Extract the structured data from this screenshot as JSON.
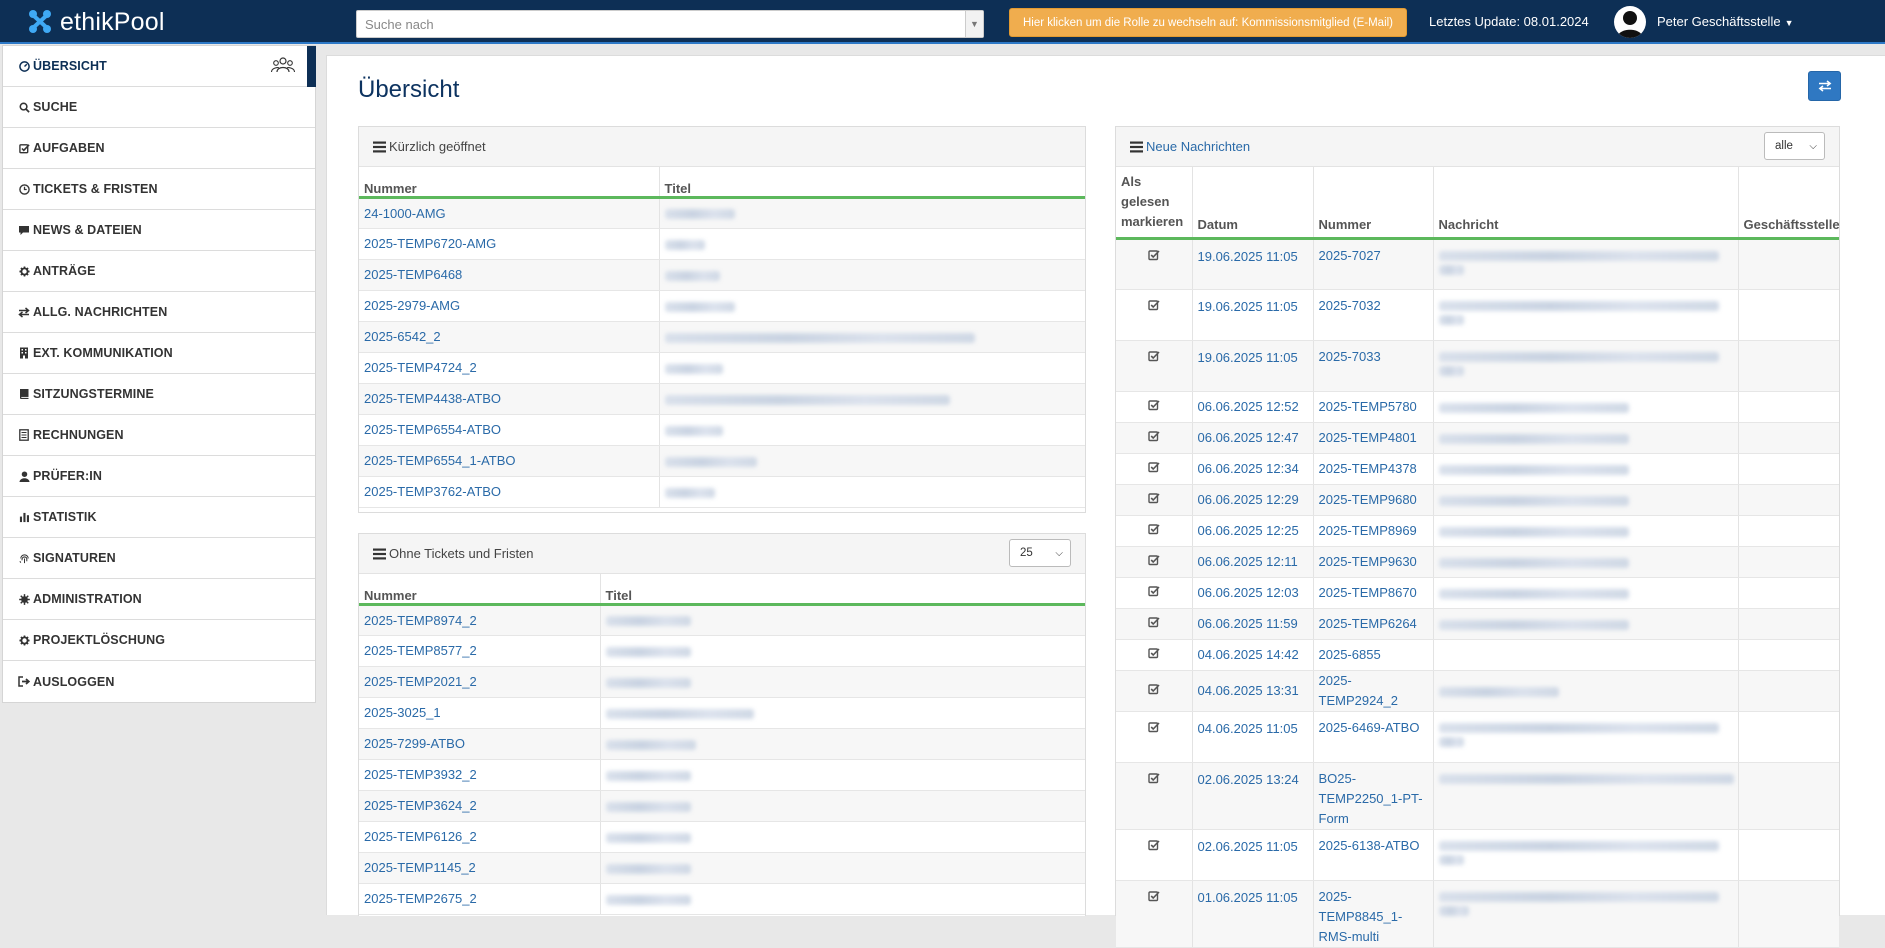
{
  "app": {
    "brand": "ethikPool",
    "search_placeholder": "Suche nach",
    "role_switch": "Hier klicken um die Rolle zu wechseln auf: Kommissionsmitglied (E-Mail)",
    "last_update": "Letztes Update: 08.01.2024",
    "user": "Peter Geschäftsstelle",
    "colors": {
      "navbar": "#0d2f55",
      "accent": "#2f78c2",
      "warning": "#f0ad4e",
      "success_line": "#5cb85c",
      "link": "#2a6aa8"
    }
  },
  "sidebar": {
    "items": [
      {
        "label": "ÜBERSICHT",
        "icon": "dashboard-icon"
      },
      {
        "label": "SUCHE",
        "icon": "search-icon"
      },
      {
        "label": "AUFGABEN",
        "icon": "checkbox-icon"
      },
      {
        "label": "TICKETS & FRISTEN",
        "icon": "clock-icon"
      },
      {
        "label": "NEWS & DATEIEN",
        "icon": "comment-icon"
      },
      {
        "label": "ANTRÄGE",
        "icon": "gear-icon"
      },
      {
        "label": "ALLG. NACHRICHTEN",
        "icon": "exchange-icon"
      },
      {
        "label": "EXT. KOMMUNIKATION",
        "icon": "building-icon"
      },
      {
        "label": "SITZUNGSTERMINE",
        "icon": "book-icon"
      },
      {
        "label": "RECHNUNGEN",
        "icon": "invoice-icon"
      },
      {
        "label": "PRÜFER:IN",
        "icon": "user-icon"
      },
      {
        "label": "STATISTIK",
        "icon": "bar-chart-icon"
      },
      {
        "label": "SIGNATUREN",
        "icon": "fingerprint-icon"
      },
      {
        "label": "ADMINISTRATION",
        "icon": "cog-icon"
      },
      {
        "label": "PROJEKTLÖSCHUNG",
        "icon": "gear-icon"
      },
      {
        "label": "AUSLOGGEN",
        "icon": "logout-icon"
      }
    ]
  },
  "main": {
    "title": "Übersicht",
    "recent": {
      "title": "Kürzlich geöffnet",
      "columns": [
        "Nummer",
        "Titel"
      ],
      "rows": [
        "24-1000-AMG",
        "2025-TEMP6720-AMG",
        "2025-TEMP6468",
        "2025-2979-AMG",
        "2025-6542_2",
        "2025-TEMP4724_2",
        "2025-TEMP4438-ATBO",
        "2025-TEMP6554-ATBO",
        "2025-TEMP6554_1-ATBO",
        "2025-TEMP3762-ATBO"
      ]
    },
    "no_tickets": {
      "title": "Ohne Tickets und Fristen",
      "page_size": "25",
      "columns": [
        "Nummer",
        "Titel"
      ],
      "rows": [
        "2025-TEMP8974_2",
        "2025-TEMP8577_2",
        "2025-TEMP2021_2",
        "2025-3025_1",
        "2025-7299-ATBO",
        "2025-TEMP3932_2",
        "2025-TEMP3624_2",
        "2025-TEMP6126_2",
        "2025-TEMP1145_2",
        "2025-TEMP2675_2"
      ]
    },
    "messages": {
      "title": "Neue Nachrichten",
      "filter": "alle",
      "columns": {
        "mark_read": "Als gelesen markieren",
        "date": "Datum",
        "number": "Nummer",
        "message": "Nachricht",
        "office": "Geschäftsstelle"
      },
      "rows": [
        {
          "date": "19.06.2025 11:05",
          "number": "2025-7027"
        },
        {
          "date": "19.06.2025 11:05",
          "number": "2025-7032"
        },
        {
          "date": "19.06.2025 11:05",
          "number": "2025-7033"
        },
        {
          "date": "06.06.2025 12:52",
          "number": "2025-TEMP5780"
        },
        {
          "date": "06.06.2025 12:47",
          "number": "2025-TEMP4801"
        },
        {
          "date": "06.06.2025 12:34",
          "number": "2025-TEMP4378"
        },
        {
          "date": "06.06.2025 12:29",
          "number": "2025-TEMP9680"
        },
        {
          "date": "06.06.2025 12:25",
          "number": "2025-TEMP8969"
        },
        {
          "date": "06.06.2025 12:11",
          "number": "2025-TEMP9630"
        },
        {
          "date": "06.06.2025 12:03",
          "number": "2025-TEMP8670"
        },
        {
          "date": "06.06.2025 11:59",
          "number": "2025-TEMP6264"
        },
        {
          "date": "04.06.2025 14:42",
          "number": "2025-6855"
        },
        {
          "date": "04.06.2025 13:31",
          "number": "2025-TEMP2924_2"
        },
        {
          "date": "04.06.2025 11:05",
          "number": "2025-6469-ATBO"
        },
        {
          "date": "02.06.2025 13:24",
          "number": "BO25-TEMP2250_1-PT-Form"
        },
        {
          "date": "02.06.2025 11:05",
          "number": "2025-6138-ATBO"
        },
        {
          "date": "01.06.2025 11:05",
          "number": "2025-TEMP8845_1-RMS-multi"
        }
      ]
    }
  }
}
